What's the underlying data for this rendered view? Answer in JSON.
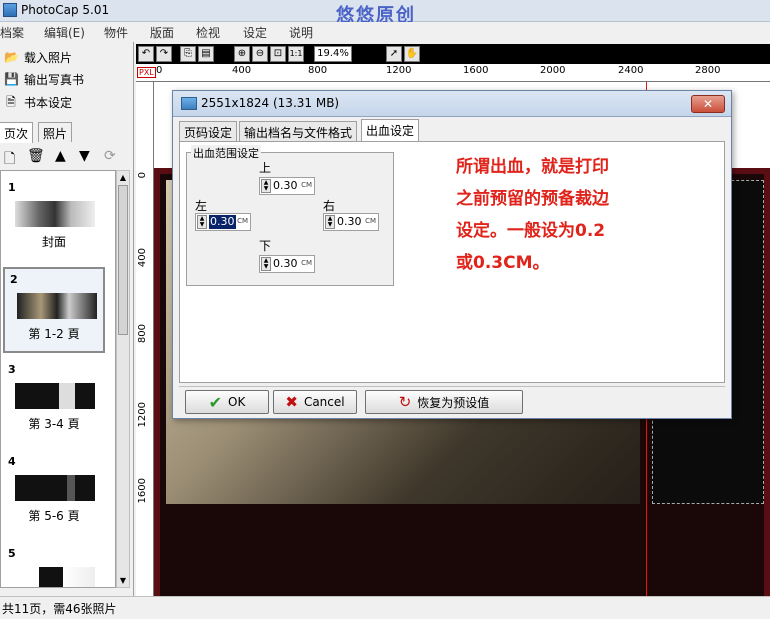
{
  "app": {
    "title": "PhotoCap 5.01",
    "watermark": "悠悠原创"
  },
  "menu": [
    "档案",
    "编辑(E)",
    "物件",
    "版面",
    "检视",
    "设定",
    "说明"
  ],
  "sidebar": {
    "actions": [
      {
        "label": "载入照片",
        "icon": "folder-open-icon"
      },
      {
        "label": "输出写真书",
        "icon": "save-icon"
      },
      {
        "label": "书本设定",
        "icon": "document-icon"
      }
    ],
    "tabs": [
      {
        "label": "页次",
        "active": true
      },
      {
        "label": "照片",
        "active": false
      }
    ],
    "toolbar": [
      "new-page-icon",
      "delete-icon",
      "move-up-icon",
      "move-down-icon",
      "refresh-icon"
    ],
    "thumbnails": [
      {
        "num": "1",
        "label": "封面",
        "selected": false
      },
      {
        "num": "2",
        "label": "第 1-2 頁",
        "selected": true
      },
      {
        "num": "3",
        "label": "第 3-4 頁",
        "selected": false
      },
      {
        "num": "4",
        "label": "第 5-6 頁",
        "selected": false
      },
      {
        "num": "5",
        "label": "",
        "selected": false
      }
    ]
  },
  "status": {
    "text": "共11页，需46张照片"
  },
  "view_toolbar": {
    "zoom": "19.4%",
    "icons": [
      "undo-icon",
      "redo-icon",
      "copy-icon",
      "paste-icon",
      "zoom-in-icon",
      "zoom-out-icon",
      "fit-icon",
      "actual-size-icon",
      "pointer-icon",
      "hand-icon"
    ]
  },
  "rulers": {
    "unit": "PXL",
    "top_ticks": [
      "0",
      "400",
      "800",
      "1200",
      "1600",
      "2000",
      "2400",
      "2800"
    ],
    "left_ticks": [
      "0",
      "400",
      "800",
      "1200",
      "1600"
    ]
  },
  "dialog": {
    "title": "2551x1824 (13.31 MB)",
    "close_label": "✕",
    "tabs": [
      {
        "label": "页码设定",
        "active": false
      },
      {
        "label": "输出档名与文件格式",
        "active": false
      },
      {
        "label": "出血设定",
        "active": true
      }
    ],
    "group_title": "出血范围设定",
    "margins": {
      "top": {
        "label": "上",
        "value": "0.30"
      },
      "left": {
        "label": "左",
        "value": "0.30"
      },
      "right": {
        "label": "右",
        "value": "0.30"
      },
      "bottom": {
        "label": "下",
        "value": "0.30"
      }
    },
    "unit": "CM",
    "note_lines": [
      "所谓出血，就是打印",
      "之前预留的预备裁边",
      "设定。一般设为0.2",
      "或0.3CM。"
    ],
    "buttons": {
      "ok": "OK",
      "cancel": "Cancel",
      "reset": "恢复为预设值"
    }
  },
  "colors": {
    "accent_red": "#e0241b",
    "frame": "#5a0d12",
    "selection": "#0a246a"
  }
}
